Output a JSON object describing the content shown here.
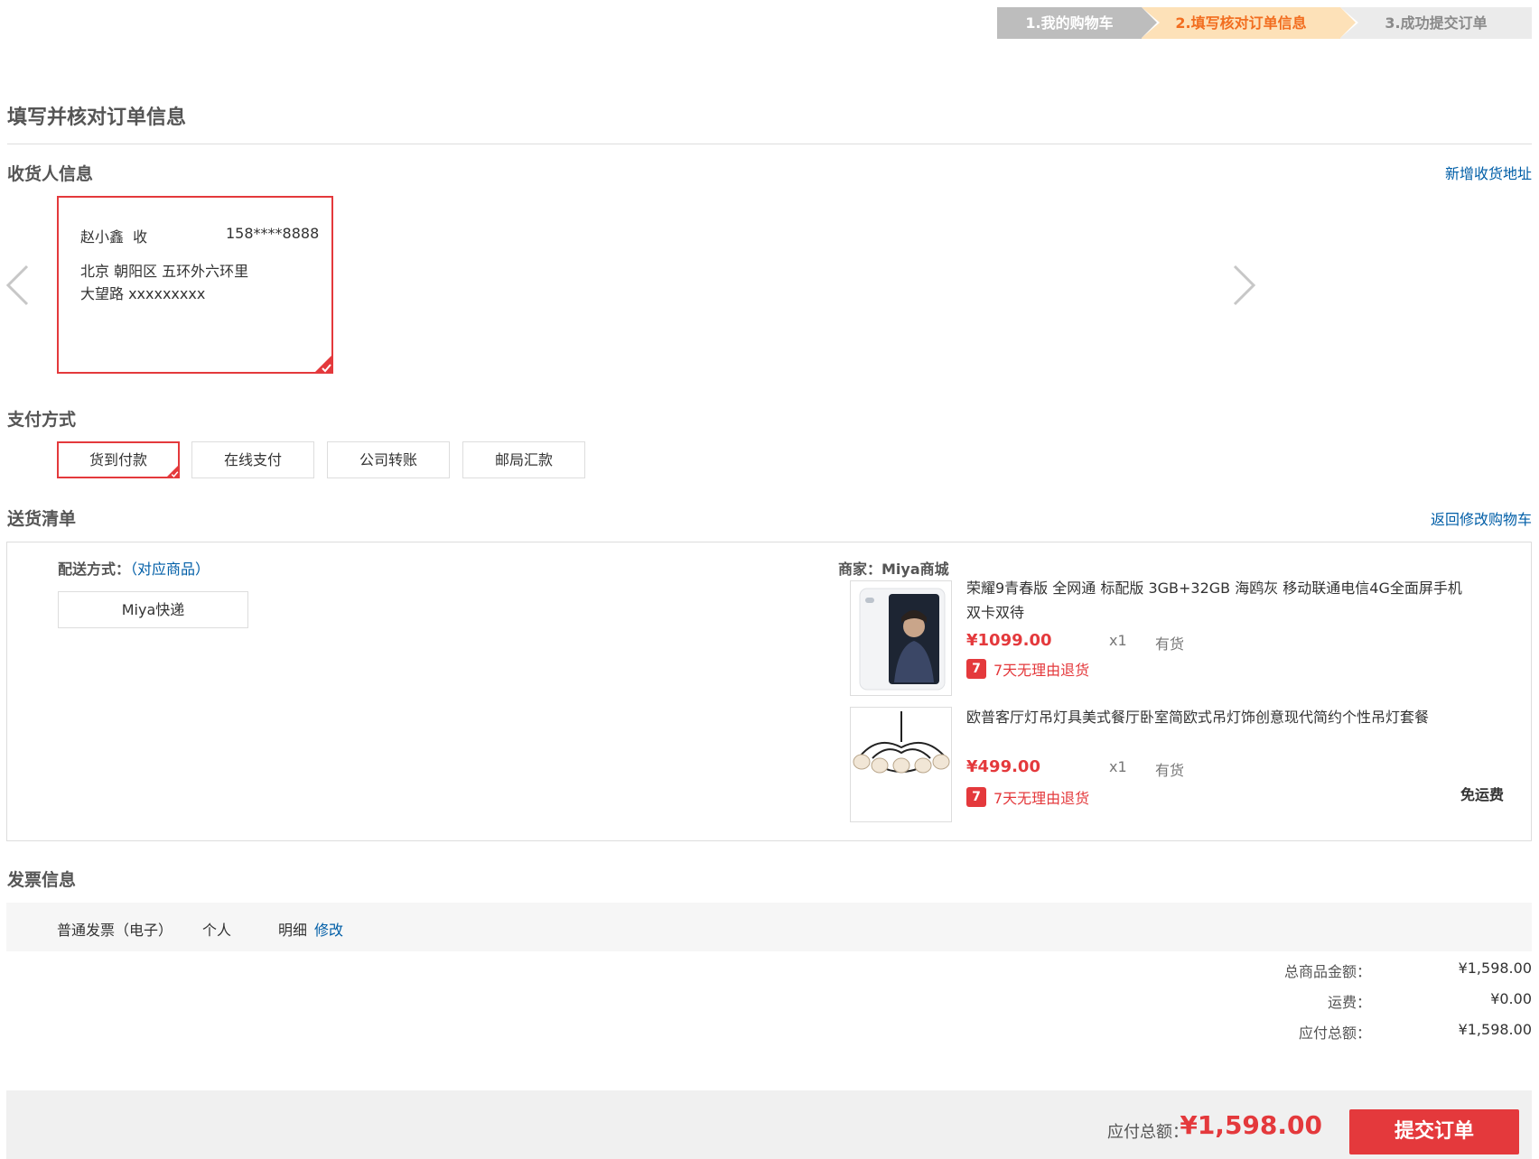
{
  "steps": [
    "1.我的购物车",
    "2.填写核对订单信息",
    "3.成功提交订单"
  ],
  "page_title": "填写并核对订单信息",
  "consignee": {
    "section_title": "收货人信息",
    "add_link": "新增收货地址",
    "name": "赵小鑫  收",
    "phone": "158****8888",
    "address_line1": "北京 朝阳区 五环外六环里",
    "address_line2": "大望路 xxxxxxxxx"
  },
  "payment": {
    "section_title": "支付方式",
    "options": [
      "货到付款",
      "在线支付",
      "公司转账",
      "邮局汇款"
    ],
    "selected": "货到付款"
  },
  "delivery": {
    "section_title": "送货清单",
    "back_link": "返回修改购物车",
    "ship_label": "配送方式：",
    "ship_link": "（对应商品）",
    "ship_option": "Miya快递",
    "merchant": "商家：Miya商城",
    "products": [
      {
        "name": "荣耀9青春版 全网通 标配版 3GB+32GB 海鸥灰 移动联通电信4G全面屏手机 双卡双待",
        "price": "¥1099.00",
        "qty": "x1",
        "stock": "有货",
        "return_policy": "7天无理由退货",
        "thumb_icon": "phone-product-image"
      },
      {
        "name": "欧普客厅灯吊灯具美式餐厅卧室简欧式吊灯饰创意现代简约个性吊灯套餐",
        "price": "¥499.00",
        "qty": "x1",
        "stock": "有货",
        "return_policy": "7天无理由退货",
        "thumb_icon": "chandelier-product-image"
      }
    ],
    "return_badge": "7",
    "free_shipping": "免运费"
  },
  "invoice": {
    "section_title": "发票信息",
    "type": "普通发票（电子）",
    "title": "个人",
    "content": "明细",
    "edit_link": "修改"
  },
  "totals": {
    "goods_label": "总商品金额：",
    "goods_value": "¥1,598.00",
    "freight_label": "运费：",
    "freight_value": "¥0.00",
    "payable_label": "应付总额：",
    "payable_value": "¥1,598.00"
  },
  "footer": {
    "payable_label": "应付总额：",
    "payable_value": "¥1,598.00",
    "submit_label": "提交订单"
  },
  "colors": {
    "accent": "#e4393c",
    "link": "#005ea7",
    "step_active": "#fde1b8",
    "step_done": "#bdbdbd"
  }
}
